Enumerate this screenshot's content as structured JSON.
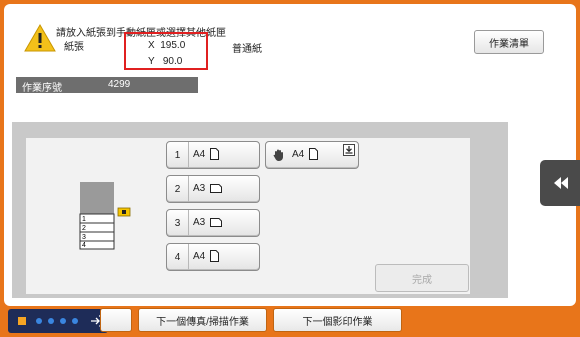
{
  "message": "請放入紙張到手動紙匣或選擇其他紙匣",
  "paper_label": "紙張",
  "x_row": "X  195.0",
  "y_row": "Y   90.0",
  "paper_type": "普通紙",
  "job_list_button": "作業清單",
  "job_number": {
    "label": "作業序號",
    "value": "4299"
  },
  "trays": [
    {
      "number": "1",
      "size": "A4",
      "orientation": "portrait"
    },
    {
      "number": "2",
      "size": "A3",
      "orientation": "landscape"
    },
    {
      "number": "3",
      "size": "A3",
      "orientation": "landscape"
    },
    {
      "number": "4",
      "size": "A4",
      "orientation": "portrait"
    }
  ],
  "bypass_tray": {
    "size": "A4",
    "orientation": "portrait",
    "icon": "hand-icon"
  },
  "machine_tray_labels": [
    "1",
    "2",
    "3",
    "4"
  ],
  "done_button": "完成",
  "bottom_buttons": {
    "next_fax_scan": "下一個傳真/掃描作業",
    "next_copy": "下一個影印作業"
  },
  "colors": {
    "frame": "#e8751a",
    "highlight_box": "#e02020",
    "status_bar": "#1e2c58",
    "job_bar": "#6e6e6e"
  }
}
